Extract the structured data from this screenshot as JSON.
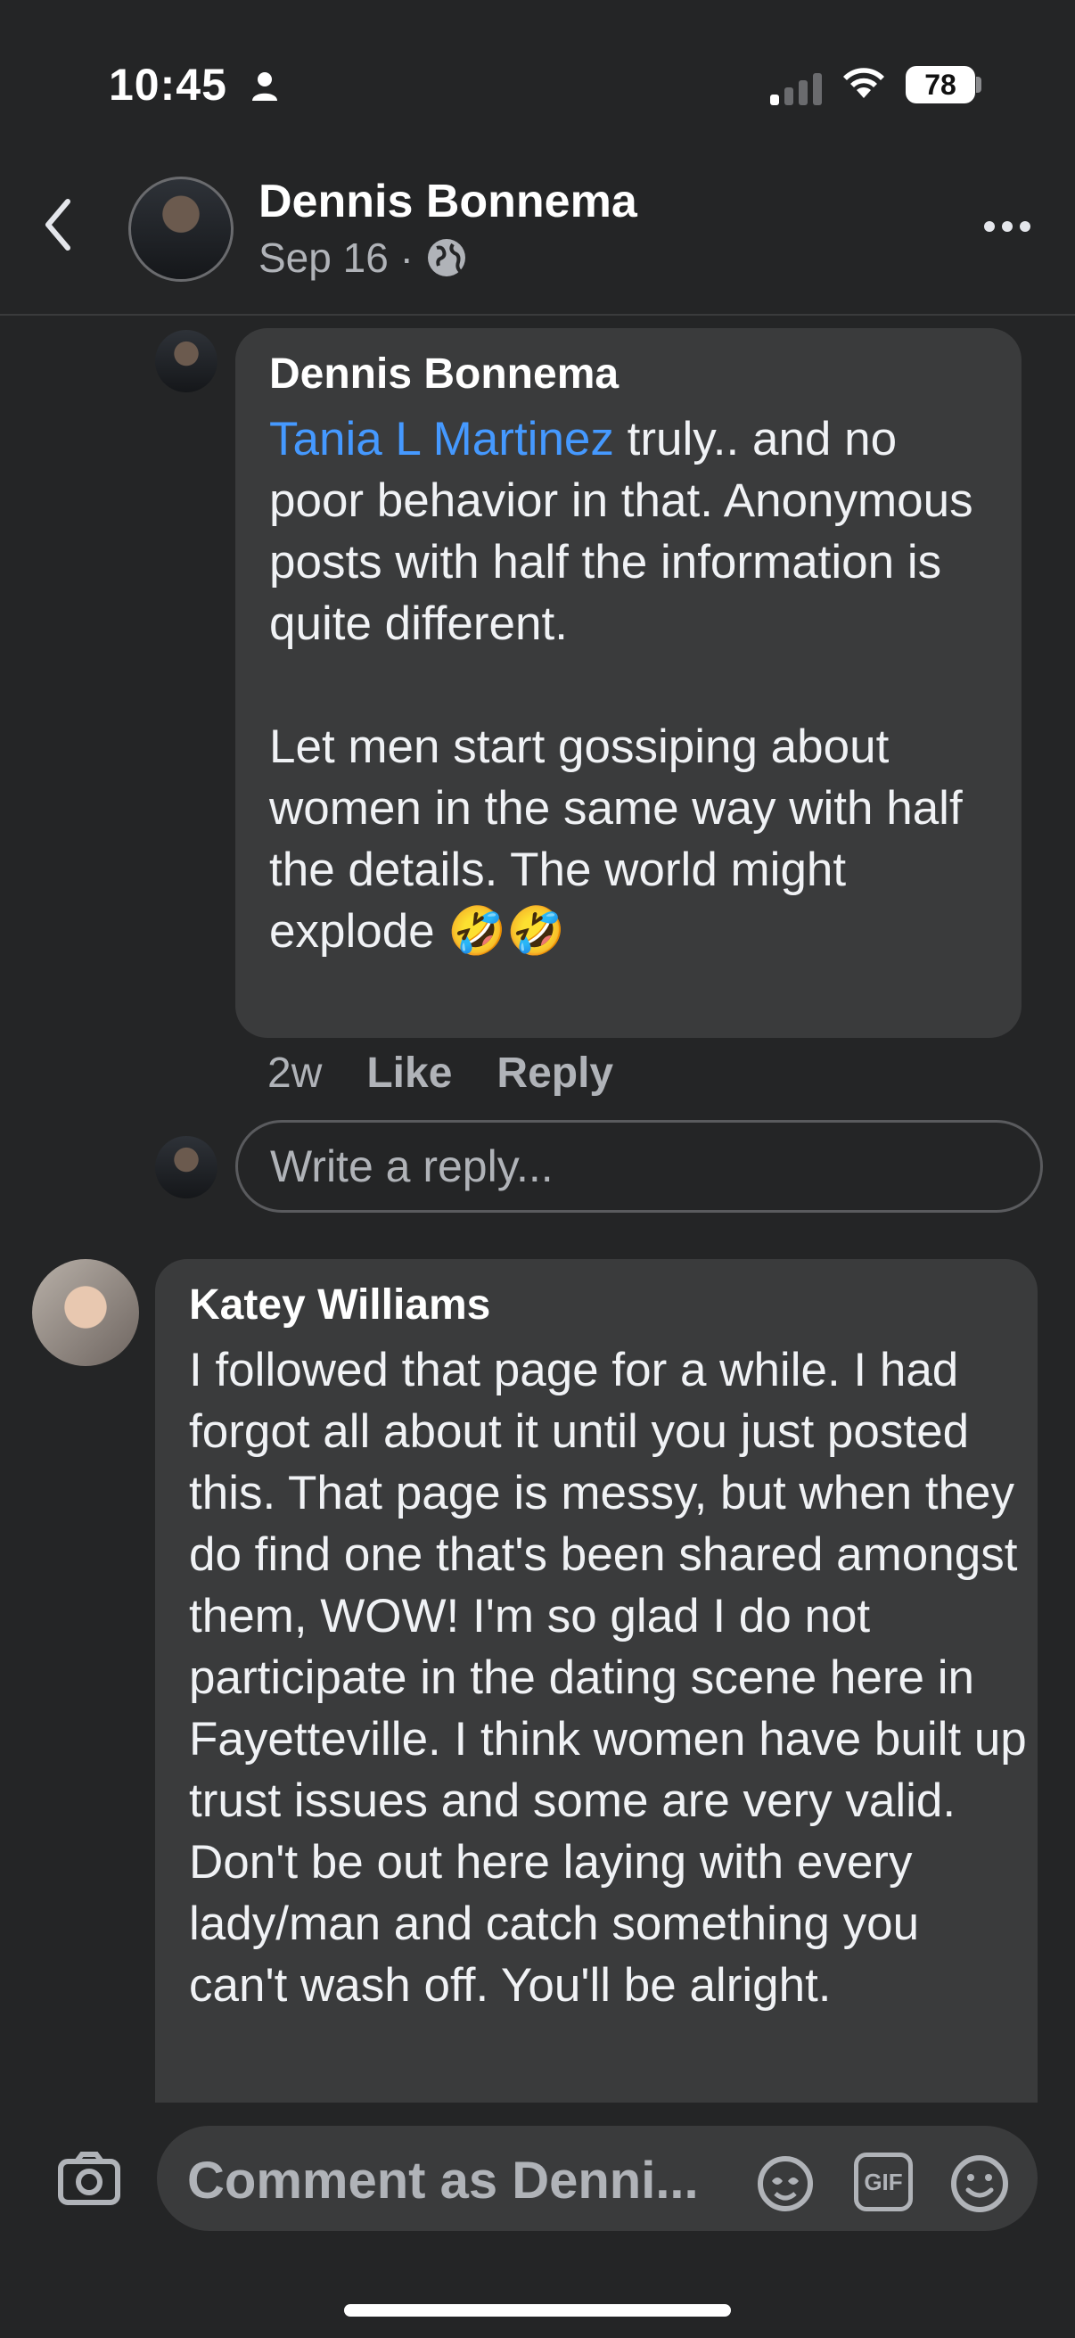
{
  "status_bar": {
    "time": "10:45",
    "battery": "78",
    "person_icon": "person-icon",
    "signal_icon": "signal-icon",
    "wifi_icon": "wifi-icon"
  },
  "header": {
    "name": "Dennis Bonnema",
    "date": "Sep 16 ·",
    "privacy_icon": "globe-icon",
    "back_icon": "chevron-left-icon",
    "more_icon": "more-icon"
  },
  "reply": {
    "author": "Dennis Bonnema",
    "mention": "Tania L Martinez",
    "text": " truly.. and no poor behavior in that. Anonymous posts with half the information is quite different.\n\nLet men start gossiping about women in the same way with half the details. The world might explode 🤣🤣",
    "time": "2w",
    "like_label": "Like",
    "reply_label": "Reply",
    "reply_placeholder": "Write a reply..."
  },
  "comment": {
    "author": "Katey Williams",
    "text": "I followed that page for a while. I had forgot all about it until you just posted this. That page is messy, but when they do find one that's been shared amongst them, WOW! I'm so glad I do not participate in the dating scene here in Fayetteville. I think women have built up trust issues and some are very valid. Don't be out here laying with every lady/man and catch something you can't wash off. You'll be alright."
  },
  "composer": {
    "placeholder": "Comment as Denni...",
    "camera_icon": "camera-icon",
    "avatar_sticker_icon": "avatar-sticker-icon",
    "gif_label": "GIF",
    "emoji_icon": "emoji-icon"
  },
  "colors": {
    "background": "#242526",
    "bubble": "#3a3b3c",
    "mention": "#4599ff",
    "secondary_text": "#b0b3b8"
  }
}
